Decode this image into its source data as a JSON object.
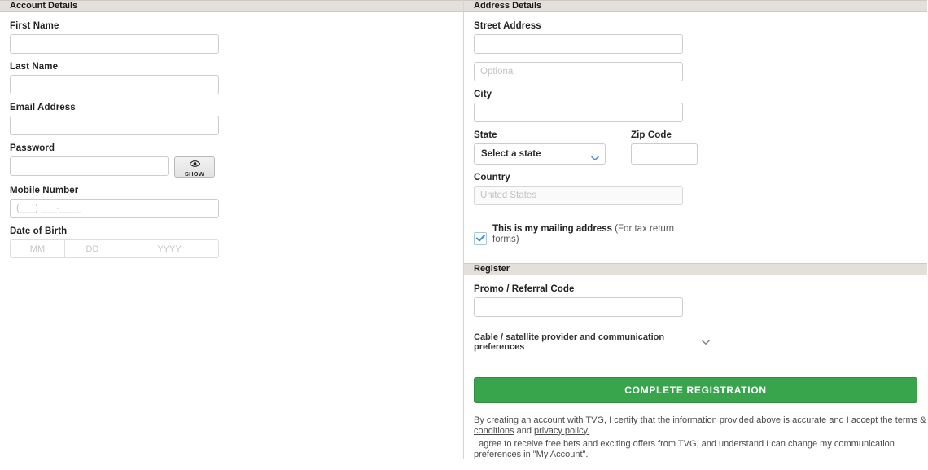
{
  "account": {
    "section_title": "Account Details",
    "fields": [
      {
        "label": "First Name",
        "value": "",
        "placeholder": ""
      },
      {
        "label": "Last Name",
        "value": "",
        "placeholder": ""
      },
      {
        "label": "Email Address",
        "value": "",
        "placeholder": ""
      }
    ],
    "password": {
      "label": "Password",
      "value": "",
      "placeholder": "",
      "show_button_label": "SHOW",
      "show_button_icon": "eye-icon"
    },
    "mobile": {
      "label": "Mobile Number",
      "value": "",
      "placeholder": "(___) ___-____"
    },
    "dob": {
      "label": "Date of Birth",
      "month_placeholder": "MM",
      "day_placeholder": "DD",
      "year_placeholder": "YYYY",
      "month_value": "",
      "day_value": "",
      "year_value": ""
    }
  },
  "address": {
    "section_title": "Address Details",
    "street": {
      "label": "Street Address",
      "value": "",
      "placeholder": ""
    },
    "street2": {
      "value": "",
      "placeholder": "Optional"
    },
    "city": {
      "label": "City",
      "value": "",
      "placeholder": ""
    },
    "state": {
      "label": "State",
      "selected": "Select a state",
      "chevron_icon": "chevron-down-icon"
    },
    "zip": {
      "label": "Zip Code",
      "value": "",
      "placeholder": ""
    },
    "country": {
      "label": "Country",
      "value": "United States",
      "disabled": true
    },
    "mailing_checkbox": {
      "checked": true,
      "label_strong": "This is my mailing address",
      "label_rest": "(For tax return forms)",
      "check_icon": "checkmark-icon"
    }
  },
  "register": {
    "section_title": "Register",
    "promo": {
      "label": "Promo / Referral Code",
      "value": "",
      "placeholder": ""
    },
    "expander": {
      "label": "Cable / satellite provider and communication preferences",
      "chevron_icon": "chevron-down-icon"
    },
    "submit_label": "COMPLETE REGISTRATION",
    "legal": {
      "line1_part1": "By creating an account with TVG, I certify that the information provided above is accurate and I accept the ",
      "terms_link": "terms & conditions",
      "line1_part2": " and ",
      "privacy_link": "privacy policy.",
      "line2": "I agree to receive free bets and exciting offers from TVG, and understand I can change my communication preferences in \"My Account\"."
    }
  },
  "colors": {
    "section_bar": "#e3dfdb",
    "cta_green": "#38a44b",
    "accent_blue": "#4a90d9",
    "field_border": "#cccccc"
  }
}
